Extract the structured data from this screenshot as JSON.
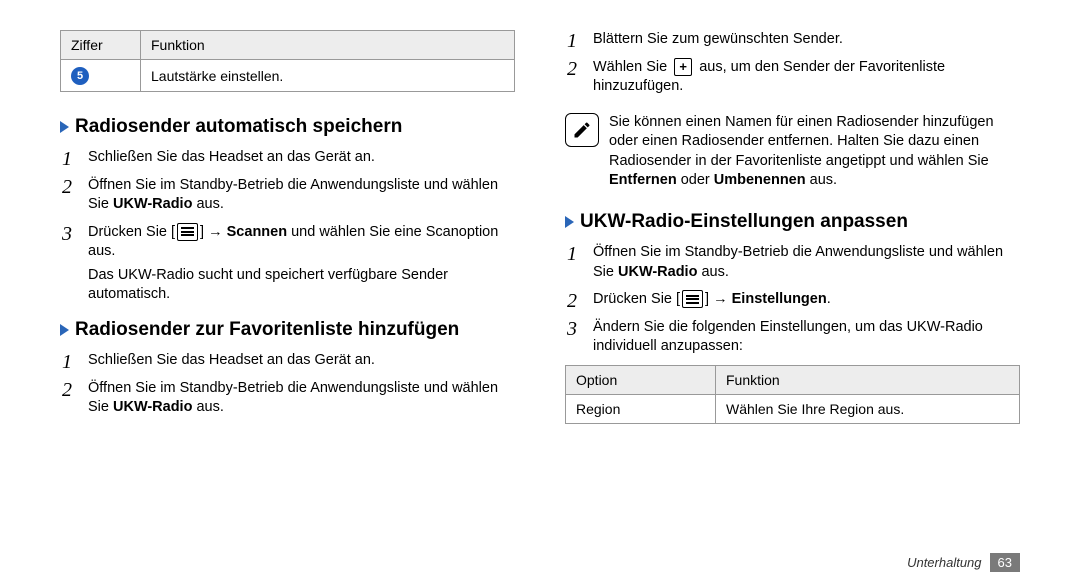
{
  "left": {
    "table": {
      "h1": "Ziffer",
      "h2": "Funktion",
      "badge": "5",
      "cell": "Lautstärke einstellen."
    },
    "sec1": {
      "title": "Radiosender automatisch speichern",
      "s1": "Schließen Sie das Headset an das Gerät an.",
      "s2a": "Öffnen Sie im Standby-Betrieb die Anwendungsliste und wählen Sie ",
      "s2b": "UKW-Radio",
      "s2c": " aus.",
      "s3a": "Drücken Sie [",
      "s3b": "] → ",
      "s3c": "Scannen",
      "s3d": " und wählen Sie eine Scanoption aus.",
      "s3sub": "Das UKW-Radio sucht und speichert verfügbare Sender automatisch."
    },
    "sec2": {
      "title": "Radiosender zur Favoritenliste hinzufügen",
      "s1": "Schließen Sie das Headset an das Gerät an.",
      "s2a": "Öffnen Sie im Standby-Betrieb die Anwendungsliste und wählen Sie ",
      "s2b": "UKW-Radio",
      "s2c": " aus."
    }
  },
  "right": {
    "s3": "Blättern Sie zum gewünschten Sender.",
    "s4a": "Wählen Sie ",
    "s4b": " aus, um den Sender der Favoritenliste hinzuzufügen.",
    "note_a": "Sie können einen Namen für einen Radiosender hinzufügen oder einen Radiosender entfernen. Halten Sie dazu einen Radiosender in der Favoritenliste angetippt und wählen Sie ",
    "note_b": "Entfernen",
    "note_c": " oder ",
    "note_d": "Umbenennen",
    "note_e": " aus.",
    "sec3": {
      "title": "UKW-Radio-Einstellungen anpassen",
      "s1a": "Öffnen Sie im Standby-Betrieb die Anwendungsliste und wählen Sie ",
      "s1b": "UKW-Radio",
      "s1c": " aus.",
      "s2a": "Drücken Sie [",
      "s2b": "] → ",
      "s2c": "Einstellungen",
      "s2d": ".",
      "s3": "Ändern Sie die folgenden Einstellungen, um das UKW-Radio individuell anzupassen:"
    },
    "table": {
      "h1": "Option",
      "h2": "Funktion",
      "r1a": "Region",
      "r1b": "Wählen Sie Ihre Region aus."
    }
  },
  "footer": {
    "section": "Unterhaltung",
    "page": "63"
  }
}
